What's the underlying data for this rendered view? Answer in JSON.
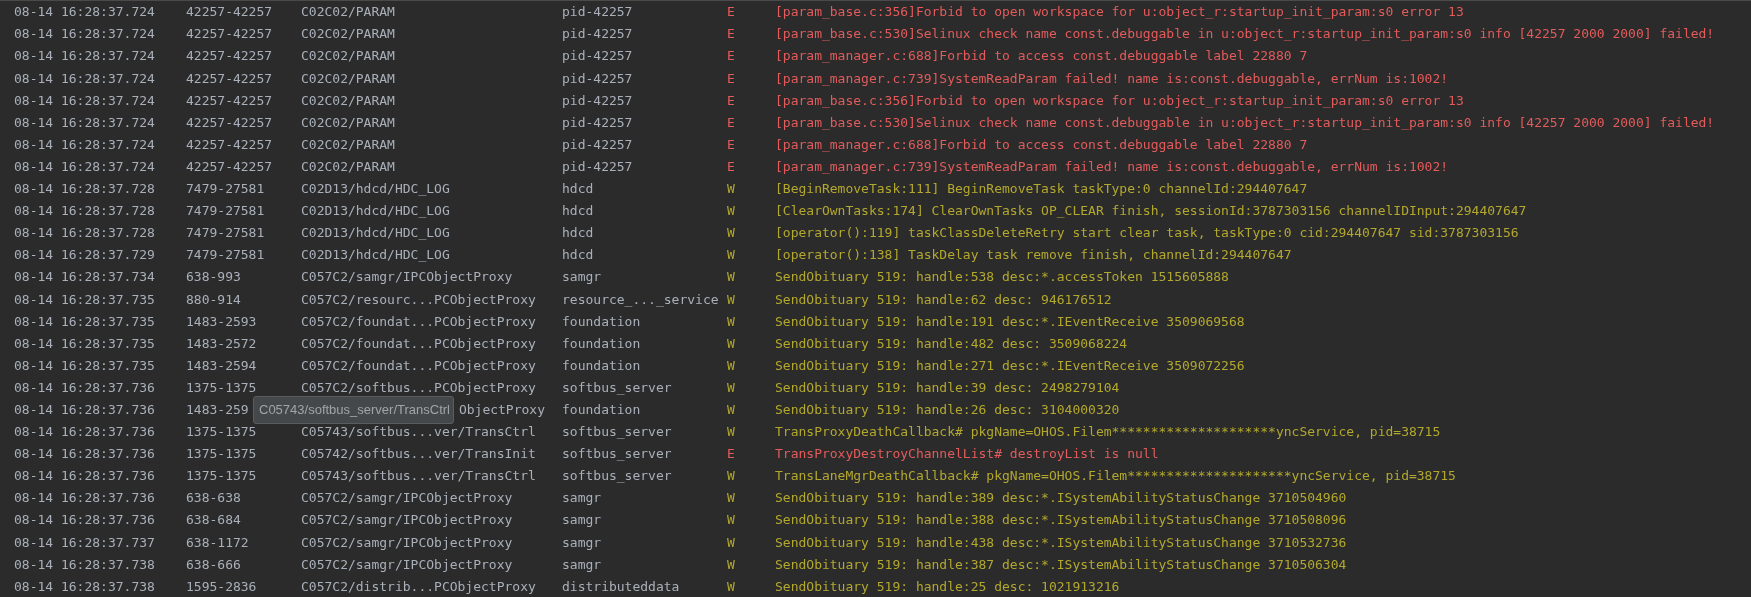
{
  "rows": [
    {
      "time": "08-14 16:28:37.724",
      "pid": "42257-42257",
      "tag": "C02C02/PARAM",
      "app": "pid-42257",
      "level": "E",
      "message": "[param_base.c:356]Forbid to open workspace for u:object_r:startup_init_param:s0 error 13"
    },
    {
      "time": "08-14 16:28:37.724",
      "pid": "42257-42257",
      "tag": "C02C02/PARAM",
      "app": "pid-42257",
      "level": "E",
      "message": "[param_base.c:530]Selinux check name const.debuggable in u:object_r:startup_init_param:s0 info [42257 2000 2000] failed!"
    },
    {
      "time": "08-14 16:28:37.724",
      "pid": "42257-42257",
      "tag": "C02C02/PARAM",
      "app": "pid-42257",
      "level": "E",
      "message": "[param_manager.c:688]Forbid to access const.debuggable label 22880 7"
    },
    {
      "time": "08-14 16:28:37.724",
      "pid": "42257-42257",
      "tag": "C02C02/PARAM",
      "app": "pid-42257",
      "level": "E",
      "message": "[param_manager.c:739]SystemReadParam failed! name is:const.debuggable, errNum is:1002!"
    },
    {
      "time": "08-14 16:28:37.724",
      "pid": "42257-42257",
      "tag": "C02C02/PARAM",
      "app": "pid-42257",
      "level": "E",
      "message": "[param_base.c:356]Forbid to open workspace for u:object_r:startup_init_param:s0 error 13"
    },
    {
      "time": "08-14 16:28:37.724",
      "pid": "42257-42257",
      "tag": "C02C02/PARAM",
      "app": "pid-42257",
      "level": "E",
      "message": "[param_base.c:530]Selinux check name const.debuggable in u:object_r:startup_init_param:s0 info [42257 2000 2000] failed!"
    },
    {
      "time": "08-14 16:28:37.724",
      "pid": "42257-42257",
      "tag": "C02C02/PARAM",
      "app": "pid-42257",
      "level": "E",
      "message": "[param_manager.c:688]Forbid to access const.debuggable label 22880 7"
    },
    {
      "time": "08-14 16:28:37.724",
      "pid": "42257-42257",
      "tag": "C02C02/PARAM",
      "app": "pid-42257",
      "level": "E",
      "message": "[param_manager.c:739]SystemReadParam failed! name is:const.debuggable, errNum is:1002!"
    },
    {
      "time": "08-14 16:28:37.728",
      "pid": "7479-27581",
      "tag": "C02D13/hdcd/HDC_LOG",
      "app": "hdcd",
      "level": "W",
      "message": "[BeginRemoveTask:111] BeginRemoveTask taskType:0 channelId:294407647"
    },
    {
      "time": "08-14 16:28:37.728",
      "pid": "7479-27581",
      "tag": "C02D13/hdcd/HDC_LOG",
      "app": "hdcd",
      "level": "W",
      "message": "[ClearOwnTasks:174] ClearOwnTasks OP_CLEAR finish, sessionId:3787303156 channelIDInput:294407647"
    },
    {
      "time": "08-14 16:28:37.728",
      "pid": "7479-27581",
      "tag": "C02D13/hdcd/HDC_LOG",
      "app": "hdcd",
      "level": "W",
      "message": "[operator():119] taskClassDeleteRetry start clear task, taskType:0 cid:294407647 sid:3787303156"
    },
    {
      "time": "08-14 16:28:37.729",
      "pid": "7479-27581",
      "tag": "C02D13/hdcd/HDC_LOG",
      "app": "hdcd",
      "level": "W",
      "message": "[operator():138] TaskDelay task remove finish, channelId:294407647"
    },
    {
      "time": "08-14 16:28:37.734",
      "pid": "638-993",
      "tag": "C057C2/samgr/IPCObjectProxy",
      "app": "samgr",
      "level": "W",
      "message": "SendObituary 519: handle:538 desc:*.accessToken 1515605888"
    },
    {
      "time": "08-14 16:28:37.735",
      "pid": "880-914",
      "tag": "C057C2/resourc...PCObjectProxy",
      "app": "resource_..._service",
      "level": "W",
      "message": "SendObituary 519: handle:62 desc: 946176512"
    },
    {
      "time": "08-14 16:28:37.735",
      "pid": "1483-2593",
      "tag": "C057C2/foundat...PCObjectProxy",
      "app": "foundation",
      "level": "W",
      "message": "SendObituary 519: handle:191 desc:*.IEventReceive 3509069568"
    },
    {
      "time": "08-14 16:28:37.735",
      "pid": "1483-2572",
      "tag": "C057C2/foundat...PCObjectProxy",
      "app": "foundation",
      "level": "W",
      "message": "SendObituary 519: handle:482 desc: 3509068224"
    },
    {
      "time": "08-14 16:28:37.735",
      "pid": "1483-2594",
      "tag": "C057C2/foundat...PCObjectProxy",
      "app": "foundation",
      "level": "W",
      "message": "SendObituary 519: handle:271 desc:*.IEventReceive 3509072256"
    },
    {
      "time": "08-14 16:28:37.736",
      "pid": "1375-1375",
      "tag": "C057C2/softbus...PCObjectProxy",
      "app": "softbus_server",
      "level": "W",
      "message": "SendObituary 519: handle:39 desc: 2498279104"
    },
    {
      "time": "08-14 16:28:37.736",
      "pid": "1483-259",
      "tag": "ObjectProxy",
      "tag_partly_hidden": true,
      "app": "foundation",
      "level": "W",
      "message": "SendObituary 519: handle:26 desc: 3104000320"
    },
    {
      "time": "08-14 16:28:37.736",
      "pid": "1375-1375",
      "tag": "C05743/softbus...ver/TransCtrl",
      "app": "softbus_server",
      "level": "W",
      "message": "TransProxyDeathCallback# pkgName=OHOS.Filem*********************yncService, pid=38715"
    },
    {
      "time": "08-14 16:28:37.736",
      "pid": "1375-1375",
      "tag": "C05742/softbus...ver/TransInit",
      "app": "softbus_server",
      "level": "E",
      "message": "TransProxyDestroyChannelList# destroyList is null"
    },
    {
      "time": "08-14 16:28:37.736",
      "pid": "1375-1375",
      "tag": "C05743/softbus...ver/TransCtrl",
      "app": "softbus_server",
      "level": "W",
      "message": "TransLaneMgrDeathCallback# pkgName=OHOS.Filem*********************yncService, pid=38715"
    },
    {
      "time": "08-14 16:28:37.736",
      "pid": "638-638",
      "tag": "C057C2/samgr/IPCObjectProxy",
      "app": "samgr",
      "level": "W",
      "message": "SendObituary 519: handle:389 desc:*.ISystemAbilityStatusChange 3710504960"
    },
    {
      "time": "08-14 16:28:37.736",
      "pid": "638-684",
      "tag": "C057C2/samgr/IPCObjectProxy",
      "app": "samgr",
      "level": "W",
      "message": "SendObituary 519: handle:388 desc:*.ISystemAbilityStatusChange 3710508096"
    },
    {
      "time": "08-14 16:28:37.737",
      "pid": "638-1172",
      "tag": "C057C2/samgr/IPCObjectProxy",
      "app": "samgr",
      "level": "W",
      "message": "SendObituary 519: handle:438 desc:*.ISystemAbilityStatusChange 3710532736"
    },
    {
      "time": "08-14 16:28:37.738",
      "pid": "638-666",
      "tag": "C057C2/samgr/IPCObjectProxy",
      "app": "samgr",
      "level": "W",
      "message": "SendObituary 519: handle:387 desc:*.ISystemAbilityStatusChange 3710506304"
    },
    {
      "time": "08-14 16:28:37.738",
      "pid": "1595-2836",
      "tag": "C057C2/distrib...PCObjectProxy",
      "app": "distributeddata",
      "level": "W",
      "message": "SendObituary 519: handle:25 desc: 1021913216"
    }
  ],
  "tooltip": {
    "text": "C05743/softbus_server/TransCtrl"
  }
}
